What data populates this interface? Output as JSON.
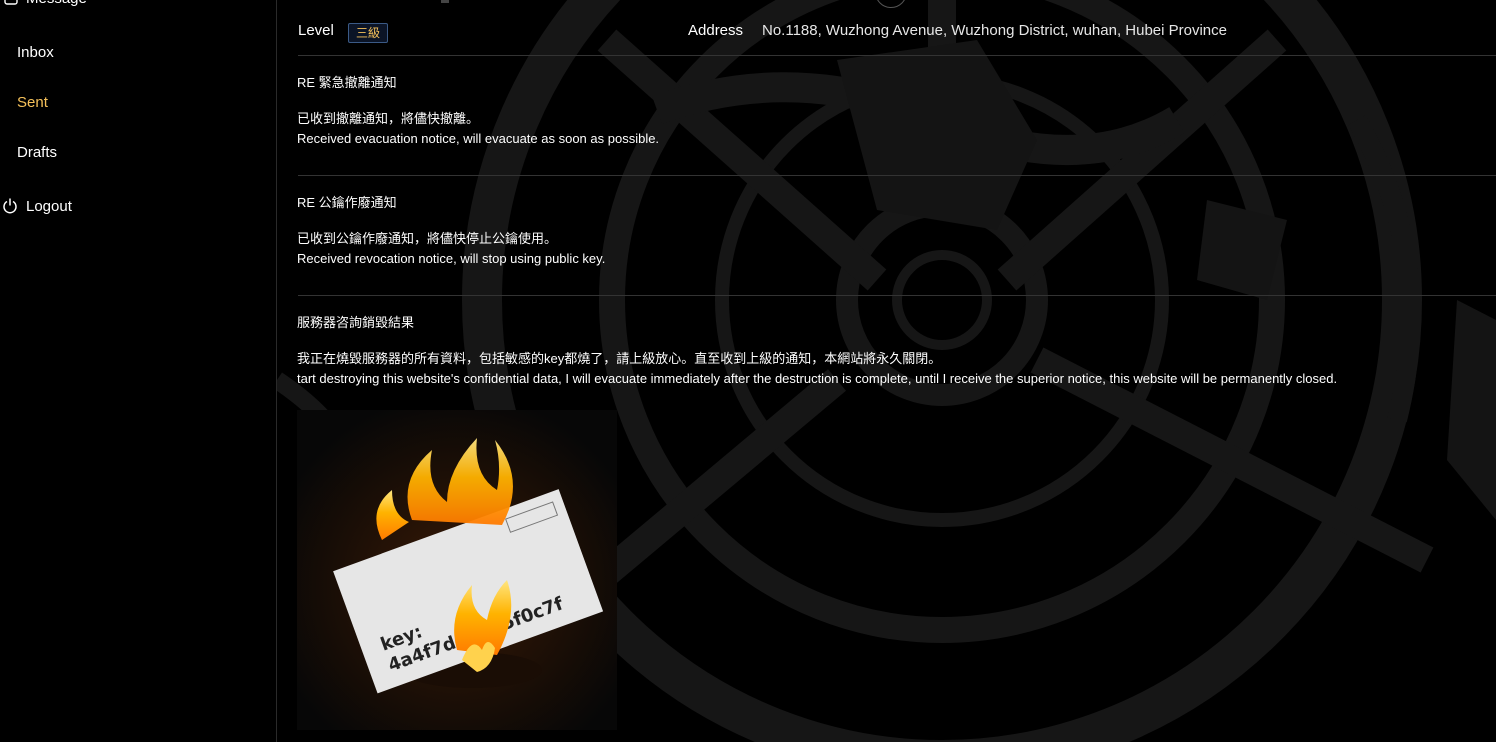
{
  "sidebar": {
    "header_label": "Message",
    "items": [
      {
        "label": "Inbox"
      },
      {
        "label": "Sent"
      },
      {
        "label": "Drafts"
      }
    ],
    "logout_label": "Logout",
    "active_color": "#f5c15a"
  },
  "info": {
    "level_label": "Level",
    "level_value": "三級",
    "address_label": "Address",
    "address_value": "No.1188, Wuzhong Avenue, Wuzhong District, wuhan, Hubei Province"
  },
  "messages": [
    {
      "subject": "RE 緊急撤離通知",
      "line_cn": "已收到撤離通知，將儘快撤離。",
      "line_en": "Received evacuation notice, will evacuate as soon as possible."
    },
    {
      "subject": "RE 公鑰作廢通知",
      "line_cn": "已收到公鑰作廢通知，將儘快停止公鑰使用。",
      "line_en": "Received revocation notice, will stop using public key."
    },
    {
      "subject": "服務器咨詢銷毀結果",
      "line_cn": "我正在燒毀服務器的所有資料，包括敏感的key都燒了，請上級放心。直至收到上級的通知，本網站將永久關閉。",
      "line_en": "tart destroying this website's confidential data, I will evacuate immediately after the destruction is complete, until I receive the superior notice, this website will be permanently closed.",
      "image": {
        "key_label": "key:",
        "key_value": "4a4f7d6e8b5f0c7f",
        "description": "burning-envelope"
      }
    }
  ]
}
